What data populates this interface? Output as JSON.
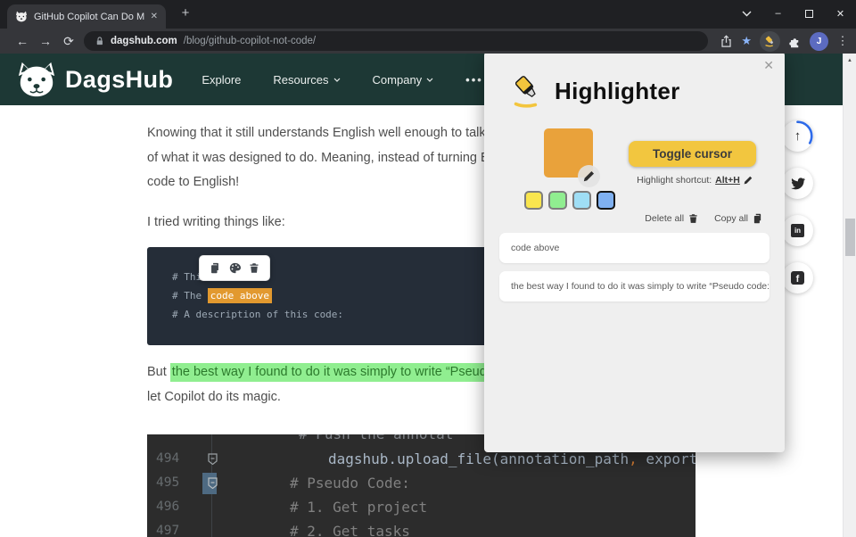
{
  "browser": {
    "tab_title": "GitHub Copilot Can Do More Tha",
    "url_host": "dagshub.com",
    "url_path": "/blog/github-copilot-not-code/",
    "avatar_initial": "J",
    "icons": {
      "back": "←",
      "forward": "→",
      "reload": "⟳",
      "close_tab": "✕",
      "new_tab": "+",
      "minimize": "–",
      "close_window": "✕",
      "menu_dots": "⋮",
      "star": "★",
      "scroll_up": "▲"
    }
  },
  "site_nav": {
    "brand": "DagsHub",
    "items": [
      "Explore",
      "Resources",
      "Company"
    ],
    "more": "•••"
  },
  "article": {
    "p1_line1": "Knowing that it still understands English well enough to talk",
    "p1_line2": "of what it was designed to do. Meaning, instead of turning E",
    "p1_line3": "code to English!",
    "p2": "I tried writing things like:",
    "p3_prefix": "But ",
    "p3_highlight": "the best way I found to do it was simply to write “Pseudo",
    "p3_line2": "let Copilot do its magic."
  },
  "code_block_1": {
    "line1": "# This",
    "line2_prefix": "# The ",
    "line2_highlight": "code above",
    "line3": "# A description of this code:"
  },
  "code_block_2": {
    "partial_line": "# Push the annotat",
    "line_494_no": "494",
    "line_494_code": "dagshub.upload_file(annotation_path",
    "line_494_comma": ",",
    "line_494_rest": " export_f",
    "line_495_no": "495",
    "line_495_code": "# Pseudo Code:",
    "line_496_no": "496",
    "line_496_code": "# 1. Get project",
    "line_497_no": "497",
    "line_497_code": "# 2. Get tasks"
  },
  "popup": {
    "title": "Highlighter",
    "close": "✕",
    "toggle_button": "Toggle cursor",
    "shortcut_label": "Highlight shortcut:",
    "shortcut_key": "Alt+H",
    "delete_all": "Delete all",
    "copy_all": "Copy all",
    "highlights": [
      "code above",
      "the best way I found to do it was simply to write “Pseudo code:”"
    ],
    "selected_color": "#e9a23b",
    "swatch_colors": [
      "#f9e54e",
      "#90ee90",
      "#9fdef5",
      "#7fb0f0"
    ],
    "button_color": "#f2c63f"
  },
  "social": {
    "arrow_up": "↑",
    "linkedin": "in",
    "facebook": "f"
  },
  "colors": {
    "navbar_teal": "#1d3835",
    "code1_bg": "#252d38",
    "code2_bg": "#2c2c2c",
    "highlight_orange": "#e2992f",
    "highlight_green": "#90ee90",
    "progress_blue": "#2e6bea",
    "bookmark_star_blue": "#8ab4f8"
  }
}
